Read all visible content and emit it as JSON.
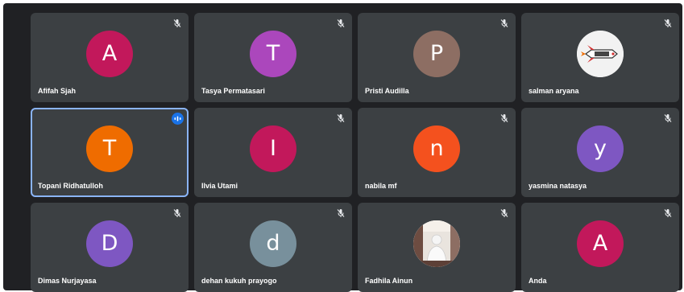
{
  "app": {
    "name": "Google Meet"
  },
  "colors": {
    "background": "#202124",
    "tile": "#3c4043",
    "active_outline": "#8ab4f8",
    "speaking_badge": "#1a73e8"
  },
  "participants": [
    {
      "name": "Afifah Sjah",
      "initial": "A",
      "avatar_color": "#c2185b",
      "muted": true
    },
    {
      "name": "Tasya Permatasari",
      "initial": "T",
      "avatar_color": "#ab47bc",
      "muted": true
    },
    {
      "name": "Pristi Audilla",
      "initial": "P",
      "avatar_color": "#8d6e63",
      "muted": true
    },
    {
      "name": "salman aryana",
      "initial": "",
      "avatar_icon": "rocket-logo-icon",
      "muted": true
    },
    {
      "name": "Topani Ridhatulloh",
      "initial": "T",
      "avatar_color": "#ef6c00",
      "muted": false,
      "speaking": true
    },
    {
      "name": "Ilvia Utami",
      "initial": "I",
      "avatar_color": "#c2185b",
      "muted": true
    },
    {
      "name": "nabila mf",
      "initial": "n",
      "avatar_color": "#f4511e",
      "muted": true
    },
    {
      "name": "yasmina natasya",
      "initial": "y",
      "avatar_color": "#7e57c2",
      "muted": true
    },
    {
      "name": "Dimas Nurjayasa",
      "initial": "D",
      "avatar_color": "#7e57c2",
      "muted": true
    },
    {
      "name": "dehan kukuh prayogo",
      "initial": "d",
      "avatar_color": "#78909c",
      "muted": true
    },
    {
      "name": "Fadhila Ainun",
      "initial": "",
      "avatar_icon": "person-photo-icon",
      "muted": true
    },
    {
      "name": "Anda",
      "initial": "A",
      "avatar_color": "#c2185b",
      "muted": true
    }
  ]
}
